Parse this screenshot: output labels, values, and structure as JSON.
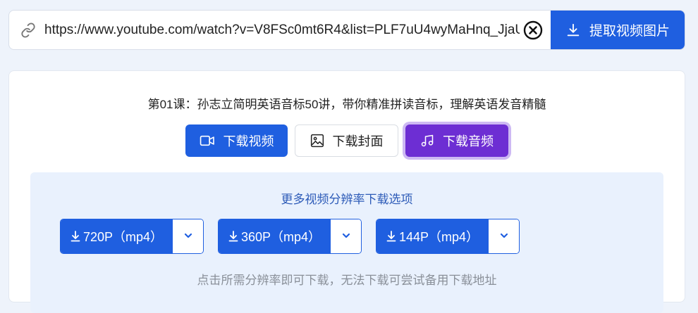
{
  "url_bar": {
    "value": "https://www.youtube.com/watch?v=V8FSc0mt6R4&list=PLF7uU4wyMaHnq_JjaU",
    "extract_label": "提取视频图片"
  },
  "card": {
    "title": "第01课：孙志立简明英语音标50讲，带你精准拼读音标，理解英语发音精髓",
    "actions": {
      "video": "下载视频",
      "cover": "下载封面",
      "audio": "下载音频"
    },
    "resolutions": {
      "heading": "更多视频分辨率下载选项",
      "options": [
        {
          "label": "720P（mp4）"
        },
        {
          "label": "360P（mp4）"
        },
        {
          "label": "144P（mp4）"
        }
      ],
      "hint": "点击所需分辨率即可下载，无法下载可尝试备用下载地址"
    }
  },
  "colors": {
    "primary": "#1f5fe0",
    "audio": "#6d2ed3",
    "panel_bg": "#e9f1fd"
  },
  "icons": {
    "link": "link-icon",
    "clear": "close-circle-icon",
    "download": "download-icon",
    "video": "video-camera-icon",
    "image": "image-icon",
    "music": "music-note-icon",
    "chevron": "chevron-down-icon"
  }
}
